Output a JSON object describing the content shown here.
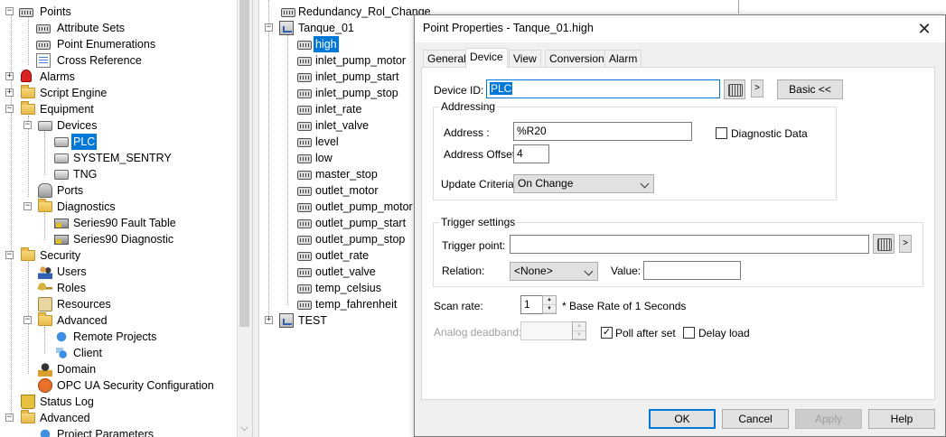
{
  "left_tree": {
    "items": [
      {
        "label": "Points",
        "icon": "points-folder-icon"
      },
      {
        "label": "Attribute Sets",
        "icon": "attribute-sets-icon"
      },
      {
        "label": "Point Enumerations",
        "icon": "point-enumerations-icon"
      },
      {
        "label": "Cross Reference",
        "icon": "cross-reference-icon"
      },
      {
        "label": "Alarms",
        "icon": "alarm-icon"
      },
      {
        "label": "Script Engine",
        "icon": "folder-icon"
      },
      {
        "label": "Equipment",
        "icon": "folder-icon"
      },
      {
        "label": "Devices",
        "icon": "devices-icon"
      },
      {
        "label": "PLC",
        "icon": "plc-device-icon"
      },
      {
        "label": "SYSTEM_SENTRY",
        "icon": "device-icon"
      },
      {
        "label": "TNG",
        "icon": "device-icon"
      },
      {
        "label": "Ports",
        "icon": "ports-icon"
      },
      {
        "label": "Diagnostics",
        "icon": "folder-icon"
      },
      {
        "label": "Series90 Fault Table",
        "icon": "diagnostic-icon"
      },
      {
        "label": "Series90 Diagnostic",
        "icon": "diagnostic-icon"
      },
      {
        "label": "Security",
        "icon": "folder-icon"
      },
      {
        "label": "Users",
        "icon": "users-icon"
      },
      {
        "label": "Roles",
        "icon": "key-icon"
      },
      {
        "label": "Resources",
        "icon": "resources-icon"
      },
      {
        "label": "Advanced",
        "icon": "folder-icon"
      },
      {
        "label": "Remote Projects",
        "icon": "remote-projects-icon"
      },
      {
        "label": "Client",
        "icon": "client-icon"
      },
      {
        "label": "Domain",
        "icon": "domain-icon"
      },
      {
        "label": "OPC UA Security Configuration",
        "icon": "opc-icon"
      },
      {
        "label": "Status Log",
        "icon": "status-log-icon"
      },
      {
        "label": "Advanced",
        "icon": "folder-icon"
      },
      {
        "label": "Project Parameters",
        "icon": "parameters-icon"
      }
    ]
  },
  "mid_tree": {
    "items": [
      {
        "label": "Redundancy_Rol_Change"
      },
      {
        "label": "Tanque_01"
      },
      {
        "label": "high"
      },
      {
        "label": "inlet_pump_motor"
      },
      {
        "label": "inlet_pump_start"
      },
      {
        "label": "inlet_pump_stop"
      },
      {
        "label": "inlet_rate"
      },
      {
        "label": "inlet_valve"
      },
      {
        "label": "level"
      },
      {
        "label": "low"
      },
      {
        "label": "master_stop"
      },
      {
        "label": "outlet_motor"
      },
      {
        "label": "outlet_pump_motor"
      },
      {
        "label": "outlet_pump_start"
      },
      {
        "label": "outlet_pump_stop"
      },
      {
        "label": "outlet_rate"
      },
      {
        "label": "outlet_valve"
      },
      {
        "label": "temp_celsius"
      },
      {
        "label": "temp_fahrenheit"
      },
      {
        "label": "TEST"
      }
    ]
  },
  "dialog": {
    "title": "Point Properties - Tanque_01.high",
    "close_glyph": "✕",
    "tabs": [
      {
        "label": "General"
      },
      {
        "label": "Device"
      },
      {
        "label": "View"
      },
      {
        "label": "Conversion"
      },
      {
        "label": "Alarm"
      }
    ],
    "device_id_label": "Device ID:",
    "device_id_value": "PLC",
    "browse_arrow": ">",
    "basic_button": "Basic <<",
    "addressing_title": "Addressing",
    "address_label": "Address :",
    "address_value": "%R20",
    "address_offset_label": "Address Offset:",
    "address_offset_value": "4",
    "diagnostic_data_label": "Diagnostic Data",
    "update_criteria_label": "Update Criteria:",
    "update_criteria_value": "On Change",
    "trigger_title": "Trigger settings",
    "trigger_point_label": "Trigger point:",
    "trigger_point_value": "",
    "trigger_arrow": ">",
    "relation_label": "Relation:",
    "relation_value": "<None>",
    "value_label": "Value:",
    "value_value": "",
    "scan_rate_label": "Scan rate:",
    "scan_rate_value": "1",
    "scan_rate_suffix": "* Base Rate of 1 Seconds",
    "analog_deadband_label": "Analog deadband:",
    "analog_deadband_value": "",
    "poll_after_set_label": "Poll after set",
    "poll_after_set_check": "✓",
    "delay_load_label": "Delay load",
    "ok_button": "OK",
    "cancel_button": "Cancel",
    "apply_button": "Apply",
    "help_button": "Help"
  }
}
